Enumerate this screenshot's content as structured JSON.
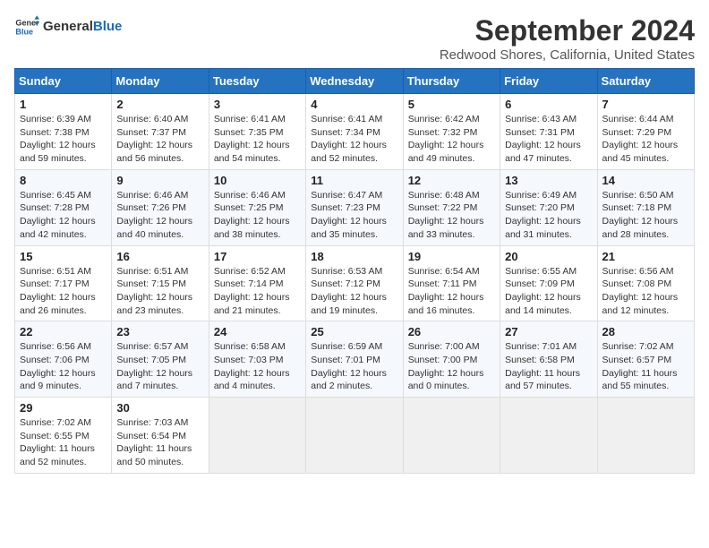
{
  "logo": {
    "text_general": "General",
    "text_blue": "Blue"
  },
  "header": {
    "title": "September 2024",
    "subtitle": "Redwood Shores, California, United States"
  },
  "weekdays": [
    "Sunday",
    "Monday",
    "Tuesday",
    "Wednesday",
    "Thursday",
    "Friday",
    "Saturday"
  ],
  "weeks": [
    [
      {
        "day": "1",
        "sunrise": "6:39 AM",
        "sunset": "7:38 PM",
        "daylight": "12 hours and 59 minutes."
      },
      {
        "day": "2",
        "sunrise": "6:40 AM",
        "sunset": "7:37 PM",
        "daylight": "12 hours and 56 minutes."
      },
      {
        "day": "3",
        "sunrise": "6:41 AM",
        "sunset": "7:35 PM",
        "daylight": "12 hours and 54 minutes."
      },
      {
        "day": "4",
        "sunrise": "6:41 AM",
        "sunset": "7:34 PM",
        "daylight": "12 hours and 52 minutes."
      },
      {
        "day": "5",
        "sunrise": "6:42 AM",
        "sunset": "7:32 PM",
        "daylight": "12 hours and 49 minutes."
      },
      {
        "day": "6",
        "sunrise": "6:43 AM",
        "sunset": "7:31 PM",
        "daylight": "12 hours and 47 minutes."
      },
      {
        "day": "7",
        "sunrise": "6:44 AM",
        "sunset": "7:29 PM",
        "daylight": "12 hours and 45 minutes."
      }
    ],
    [
      {
        "day": "8",
        "sunrise": "6:45 AM",
        "sunset": "7:28 PM",
        "daylight": "12 hours and 42 minutes."
      },
      {
        "day": "9",
        "sunrise": "6:46 AM",
        "sunset": "7:26 PM",
        "daylight": "12 hours and 40 minutes."
      },
      {
        "day": "10",
        "sunrise": "6:46 AM",
        "sunset": "7:25 PM",
        "daylight": "12 hours and 38 minutes."
      },
      {
        "day": "11",
        "sunrise": "6:47 AM",
        "sunset": "7:23 PM",
        "daylight": "12 hours and 35 minutes."
      },
      {
        "day": "12",
        "sunrise": "6:48 AM",
        "sunset": "7:22 PM",
        "daylight": "12 hours and 33 minutes."
      },
      {
        "day": "13",
        "sunrise": "6:49 AM",
        "sunset": "7:20 PM",
        "daylight": "12 hours and 31 minutes."
      },
      {
        "day": "14",
        "sunrise": "6:50 AM",
        "sunset": "7:18 PM",
        "daylight": "12 hours and 28 minutes."
      }
    ],
    [
      {
        "day": "15",
        "sunrise": "6:51 AM",
        "sunset": "7:17 PM",
        "daylight": "12 hours and 26 minutes."
      },
      {
        "day": "16",
        "sunrise": "6:51 AM",
        "sunset": "7:15 PM",
        "daylight": "12 hours and 23 minutes."
      },
      {
        "day": "17",
        "sunrise": "6:52 AM",
        "sunset": "7:14 PM",
        "daylight": "12 hours and 21 minutes."
      },
      {
        "day": "18",
        "sunrise": "6:53 AM",
        "sunset": "7:12 PM",
        "daylight": "12 hours and 19 minutes."
      },
      {
        "day": "19",
        "sunrise": "6:54 AM",
        "sunset": "7:11 PM",
        "daylight": "12 hours and 16 minutes."
      },
      {
        "day": "20",
        "sunrise": "6:55 AM",
        "sunset": "7:09 PM",
        "daylight": "12 hours and 14 minutes."
      },
      {
        "day": "21",
        "sunrise": "6:56 AM",
        "sunset": "7:08 PM",
        "daylight": "12 hours and 12 minutes."
      }
    ],
    [
      {
        "day": "22",
        "sunrise": "6:56 AM",
        "sunset": "7:06 PM",
        "daylight": "12 hours and 9 minutes."
      },
      {
        "day": "23",
        "sunrise": "6:57 AM",
        "sunset": "7:05 PM",
        "daylight": "12 hours and 7 minutes."
      },
      {
        "day": "24",
        "sunrise": "6:58 AM",
        "sunset": "7:03 PM",
        "daylight": "12 hours and 4 minutes."
      },
      {
        "day": "25",
        "sunrise": "6:59 AM",
        "sunset": "7:01 PM",
        "daylight": "12 hours and 2 minutes."
      },
      {
        "day": "26",
        "sunrise": "7:00 AM",
        "sunset": "7:00 PM",
        "daylight": "12 hours and 0 minutes."
      },
      {
        "day": "27",
        "sunrise": "7:01 AM",
        "sunset": "6:58 PM",
        "daylight": "11 hours and 57 minutes."
      },
      {
        "day": "28",
        "sunrise": "7:02 AM",
        "sunset": "6:57 PM",
        "daylight": "11 hours and 55 minutes."
      }
    ],
    [
      {
        "day": "29",
        "sunrise": "7:02 AM",
        "sunset": "6:55 PM",
        "daylight": "11 hours and 52 minutes."
      },
      {
        "day": "30",
        "sunrise": "7:03 AM",
        "sunset": "6:54 PM",
        "daylight": "11 hours and 50 minutes."
      },
      null,
      null,
      null,
      null,
      null
    ]
  ]
}
